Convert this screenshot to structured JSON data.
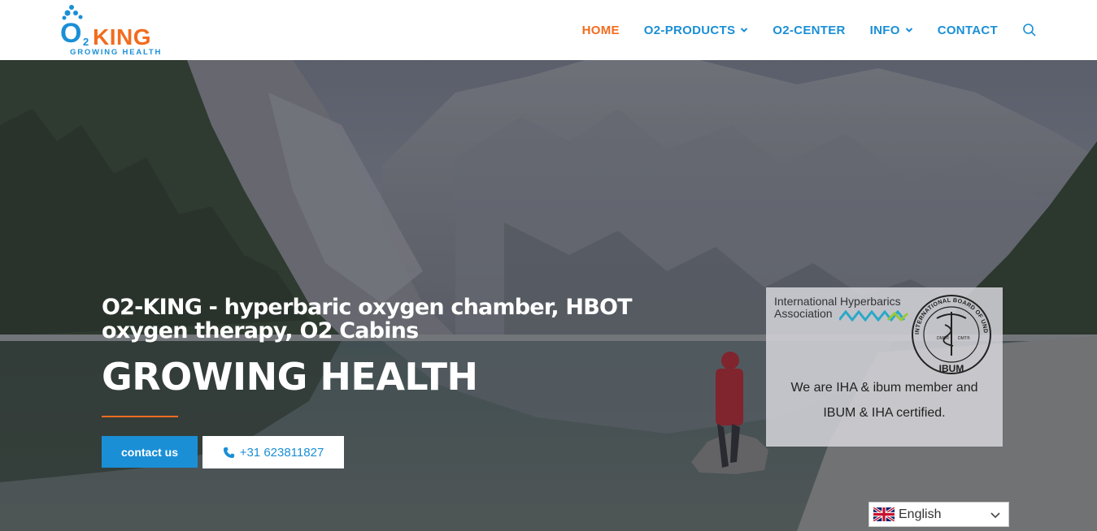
{
  "brand": {
    "logo_mark": "O2KING",
    "tagline": "GROWING HEALTH",
    "primary_color": "#1a8fd6",
    "accent_color": "#f26c1f"
  },
  "nav": {
    "items": [
      {
        "label": "HOME",
        "active": true,
        "has_dropdown": false
      },
      {
        "label": "O2-PRODUCTS",
        "active": false,
        "has_dropdown": true
      },
      {
        "label": "O2-CENTER",
        "active": false,
        "has_dropdown": false
      },
      {
        "label": "INFO",
        "active": false,
        "has_dropdown": true
      },
      {
        "label": "CONTACT",
        "active": false,
        "has_dropdown": false
      }
    ],
    "search_icon": "search-icon"
  },
  "hero": {
    "subtitle": "O2-KING - hyperbaric oxygen chamber, HBOT oxygen therapy, O2 Cabins",
    "headline": "GROWING HEALTH",
    "primary_button": "contact us",
    "phone_button": "+31 623811827",
    "phone_icon": "phone-icon"
  },
  "certification": {
    "iha_name_line1": "International Hyperbarics",
    "iha_name_line2": "Association",
    "ibum_seal_text": "INTERNATIONAL BOARD OF UNDERSEA MEDICINE",
    "ibum_label": "IBUM",
    "seal_left": "DMO®",
    "seal_right": "DMT®",
    "text_line1": "We are IHA & ibum member and",
    "text_line2": "IBUM & IHA certified."
  },
  "language": {
    "selected": "English",
    "flag_icon": "uk-flag-icon"
  }
}
